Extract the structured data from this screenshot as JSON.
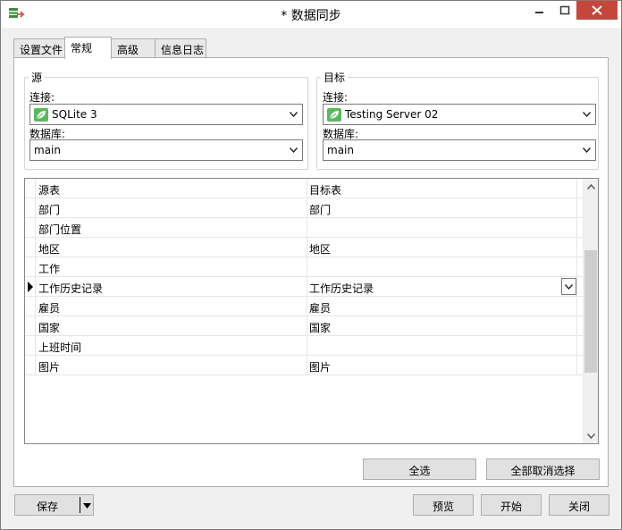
{
  "window": {
    "title": "* 数据同步"
  },
  "tabs": [
    {
      "label": "设置文件",
      "active": false
    },
    {
      "label": "常规",
      "active": true
    },
    {
      "label": "高级",
      "active": false
    },
    {
      "label": "信息日志",
      "active": false
    }
  ],
  "source": {
    "legend": "源",
    "connection_label": "连接:",
    "connection_value": "SQLite 3",
    "database_label": "数据库:",
    "database_value": "main"
  },
  "target": {
    "legend": "目标",
    "connection_label": "连接:",
    "connection_value": "Testing Server 02",
    "database_label": "数据库:",
    "database_value": "main"
  },
  "grid": {
    "headers": [
      "源表",
      "目标表"
    ],
    "rows": [
      {
        "source": "部门",
        "target": "部门"
      },
      {
        "source": "部门位置",
        "target": ""
      },
      {
        "source": "地区",
        "target": "地区"
      },
      {
        "source": "工作",
        "target": ""
      },
      {
        "source": "工作历史记录",
        "target": "工作历史记录"
      },
      {
        "source": "雇员",
        "target": "雇员"
      },
      {
        "source": "国家",
        "target": "国家"
      },
      {
        "source": "上班时间",
        "target": ""
      },
      {
        "source": "图片",
        "target": "图片"
      }
    ],
    "current_row": 4
  },
  "buttons": {
    "select_all": "全选",
    "deselect_all": "全部取消选择",
    "save": "保存",
    "preview": "预览",
    "start": "开始",
    "close": "关闭"
  },
  "colors": {
    "close_button": "#c7463c",
    "connection_icon": "#5cb85c"
  },
  "icons": {
    "app": "data-sync-app-icon",
    "connection": "sqlite-leaf-icon",
    "dropdown": "chevron-down-icon"
  }
}
